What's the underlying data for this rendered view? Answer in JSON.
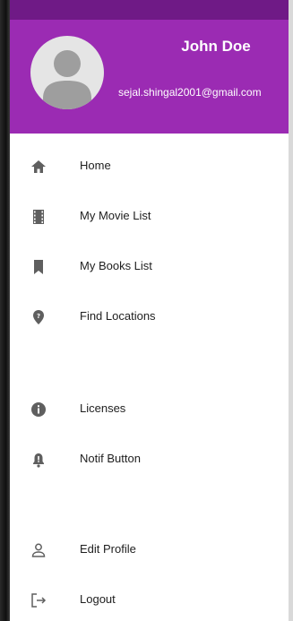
{
  "header": {
    "name": "John Doe",
    "email": "sejal.shingal2001@gmail.com"
  },
  "menu": {
    "items": [
      {
        "label": "Home",
        "icon": "home-icon"
      },
      {
        "label": "My Movie List",
        "icon": "film-icon"
      },
      {
        "label": "My Books List",
        "icon": "bookmark-icon"
      },
      {
        "label": "Find Locations",
        "icon": "location-pin-icon"
      },
      {
        "label": "Licenses",
        "icon": "info-icon"
      },
      {
        "label": "Notif Button",
        "icon": "bell-icon"
      },
      {
        "label": "Edit Profile",
        "icon": "person-outline-icon"
      },
      {
        "label": "Logout",
        "icon": "logout-icon"
      }
    ]
  },
  "colors": {
    "header_bg": "#9b2bb3",
    "status_bar": "#6f1a86",
    "icon_color": "#5f5f5f"
  }
}
